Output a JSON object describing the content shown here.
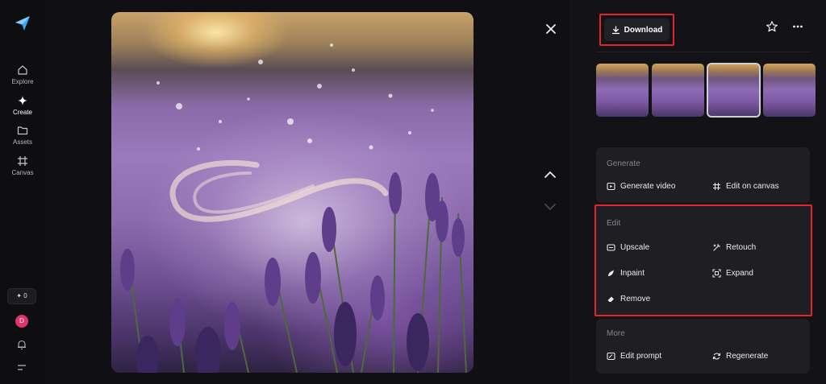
{
  "nav": {
    "items": [
      {
        "label": "Explore",
        "icon": "home-icon"
      },
      {
        "label": "Create",
        "icon": "sparkle-icon"
      },
      {
        "label": "Assets",
        "icon": "folder-icon"
      },
      {
        "label": "Canvas",
        "icon": "canvas-icon"
      }
    ],
    "credits": "0",
    "avatar_initial": "D"
  },
  "toolbar": {
    "download_label": "Download"
  },
  "sections": {
    "generate": {
      "title": "Generate",
      "actions": [
        "Generate video",
        "Edit on canvas"
      ]
    },
    "edit": {
      "title": "Edit",
      "actions": [
        "Upscale",
        "Retouch",
        "Inpaint",
        "Expand",
        "Remove"
      ]
    },
    "more": {
      "title": "More",
      "actions": [
        "Edit prompt",
        "Regenerate"
      ]
    }
  },
  "colors": {
    "highlight": "#e1252a",
    "avatar": "#e0336b",
    "panel": "#131317",
    "card": "#1e1e23"
  }
}
